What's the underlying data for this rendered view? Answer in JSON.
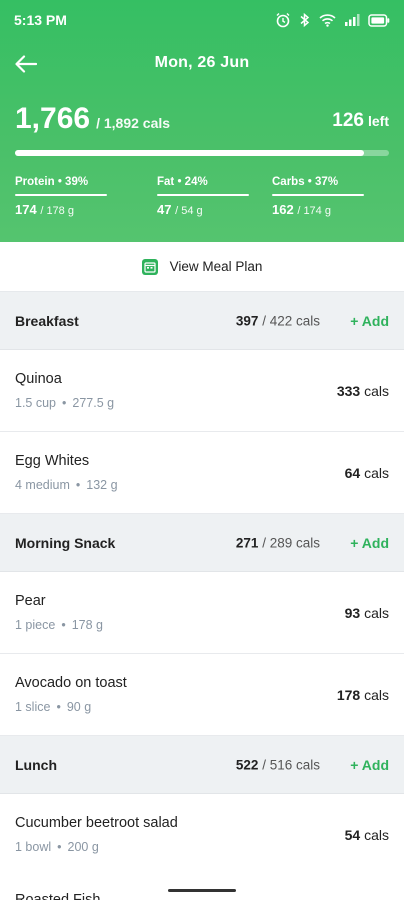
{
  "status_bar": {
    "time": "5:13 PM"
  },
  "header": {
    "date": "Mon, 26 Jun",
    "calories_eaten": "1,766",
    "calories_goal": "/ 1,892 cals",
    "calories_left_value": "126",
    "calories_left_label": "left",
    "progress_fraction": 0.933,
    "macros": [
      {
        "label": "Protein",
        "percent": "39%",
        "current": "174",
        "target": "/ 178 g"
      },
      {
        "label": "Fat",
        "percent": "24%",
        "current": "47",
        "target": "/ 54 g"
      },
      {
        "label": "Carbs",
        "percent": "37%",
        "current": "162",
        "target": "/ 174 g"
      }
    ],
    "accent_color": "#35bf63"
  },
  "meal_plan": {
    "icon_text": "14",
    "label": "View Meal Plan"
  },
  "sections": [
    {
      "title": "Breakfast",
      "current": "397",
      "target": "/ 422 cals",
      "add_label": "+ Add",
      "items": [
        {
          "name": "Quinoa",
          "amount": "1.5 cup",
          "weight": "277.5 g",
          "cals": "333",
          "unit": "cals"
        },
        {
          "name": "Egg Whites",
          "amount": "4 medium",
          "weight": "132 g",
          "cals": "64",
          "unit": "cals"
        }
      ]
    },
    {
      "title": "Morning Snack",
      "current": "271",
      "target": "/ 289 cals",
      "add_label": "+ Add",
      "items": [
        {
          "name": "Pear",
          "amount": "1 piece",
          "weight": "178 g",
          "cals": "93",
          "unit": "cals"
        },
        {
          "name": "Avocado on toast",
          "amount": "1 slice",
          "weight": "90 g",
          "cals": "178",
          "unit": "cals"
        }
      ]
    },
    {
      "title": "Lunch",
      "current": "522",
      "target": "/ 516 cals",
      "add_label": "+ Add",
      "items": [
        {
          "name": "Cucumber beetroot salad",
          "amount": "1 bowl",
          "weight": "200 g",
          "cals": "54",
          "unit": "cals"
        }
      ]
    }
  ],
  "partial_item": {
    "name": "Roasted Fish"
  }
}
